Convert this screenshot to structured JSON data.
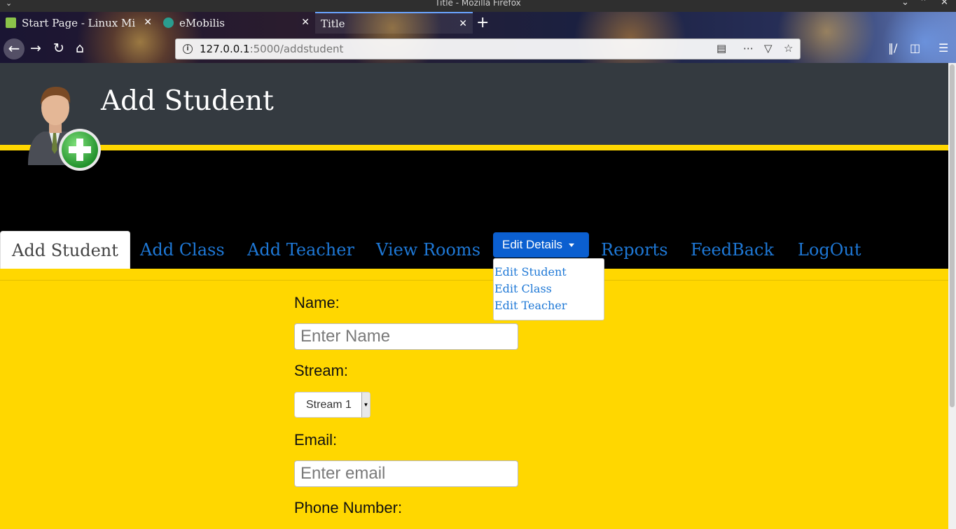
{
  "window": {
    "title": "Title - Mozilla Firefox"
  },
  "tabs": [
    {
      "label": "Start Page - Linux Mi",
      "favicon_color": "#8bc34a"
    },
    {
      "label": "eMobilis",
      "favicon_color": "#2a9d8f"
    },
    {
      "label": "Title",
      "favicon_color": ""
    }
  ],
  "urlbar": {
    "host": "127.0.0.1",
    "path": ":5000/addstudent"
  },
  "header": {
    "title": "Add Student"
  },
  "nav": {
    "items": [
      "Add Student",
      "Add Class",
      "Add Teacher",
      "View Rooms"
    ],
    "dropdown_label": "Edit Details",
    "dropdown_items": [
      "Edit Student",
      "Edit Class",
      "Edit Teacher"
    ],
    "items_right": [
      "Reports",
      "FeedBack",
      "LogOut"
    ]
  },
  "form": {
    "name_label": "Name:",
    "name_placeholder": "Enter Name",
    "stream_label": "Stream:",
    "stream_value": "Stream 1",
    "email_label": "Email:",
    "email_placeholder": "Enter email",
    "phone_label": "Phone Number:"
  },
  "colors": {
    "banner": "#343a40",
    "accent": "#ffd700",
    "link": "#1e78d6",
    "button": "#0b5fd0"
  }
}
